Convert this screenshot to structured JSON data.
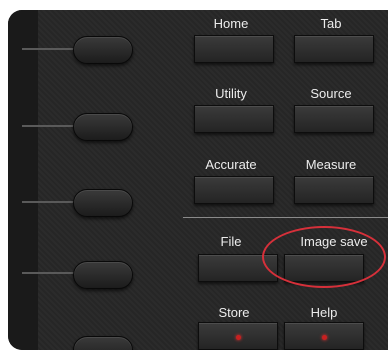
{
  "front_panel": {
    "keys": {
      "home": "Home",
      "tab": "Tab",
      "utility": "Utility",
      "source": "Source",
      "accurate": "Accurate",
      "measure": "Measure",
      "file": "File",
      "image_save": "Image save",
      "store": "Store",
      "help": "Help"
    },
    "led_color": "#c82020",
    "annotation_color": "#d6303a"
  }
}
